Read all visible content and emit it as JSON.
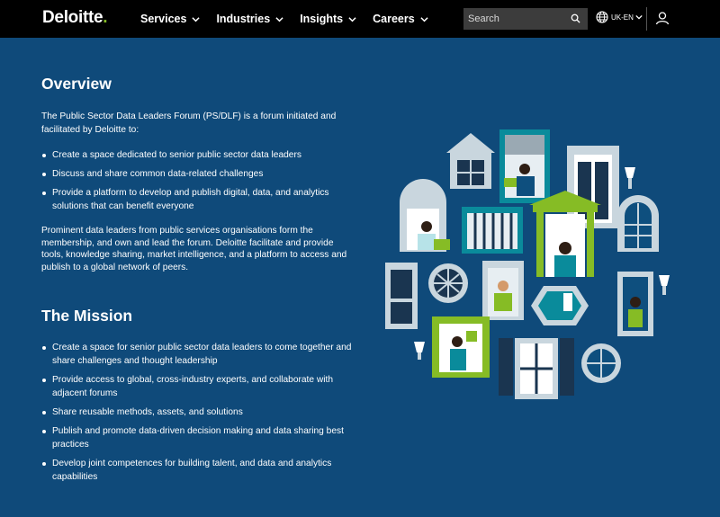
{
  "header": {
    "logo_text": "Deloitte",
    "logo_dot": ".",
    "nav": [
      {
        "label": "Services"
      },
      {
        "label": "Industries"
      },
      {
        "label": "Insights"
      },
      {
        "label": "Careers"
      }
    ],
    "search": {
      "placeholder": "Search",
      "icon": "search-icon"
    },
    "language": {
      "label": "UK-EN",
      "icon": "globe-icon"
    },
    "user_icon": "user-icon"
  },
  "overview": {
    "title": "Overview",
    "intro": "The Public Sector Data Leaders Forum (PS/DLF) is a forum initiated and facilitated by Deloitte to:",
    "bullets": [
      "Create a space dedicated to senior public sector data leaders",
      "Discuss and share common data-related challenges",
      "Provide a platform to develop and publish digital, data, and analytics solutions that can benefit everyone"
    ],
    "paragraph": "Prominent data leaders from public services organisations form the membership, and own and lead the forum. Deloitte facilitate and provide tools, knowledge sharing, market intelligence, and a platform to access and publish to a global network of peers."
  },
  "mission": {
    "title": "The Mission",
    "bullets": [
      "Create a space for senior public sector data leaders to come together and share challenges and thought leadership",
      "Provide access to global, cross-industry experts, and collaborate with adjacent forums",
      "Share reusable methods, assets, and solutions",
      "Publish and promote data-driven decision making and data sharing best practices",
      "Develop joint competences for building talent, and data and analytics capabilities"
    ]
  },
  "colors": {
    "background": "#0f4a7a",
    "header": "#000000",
    "brand_green": "#86bc25",
    "teal": "#0a8b9b"
  }
}
